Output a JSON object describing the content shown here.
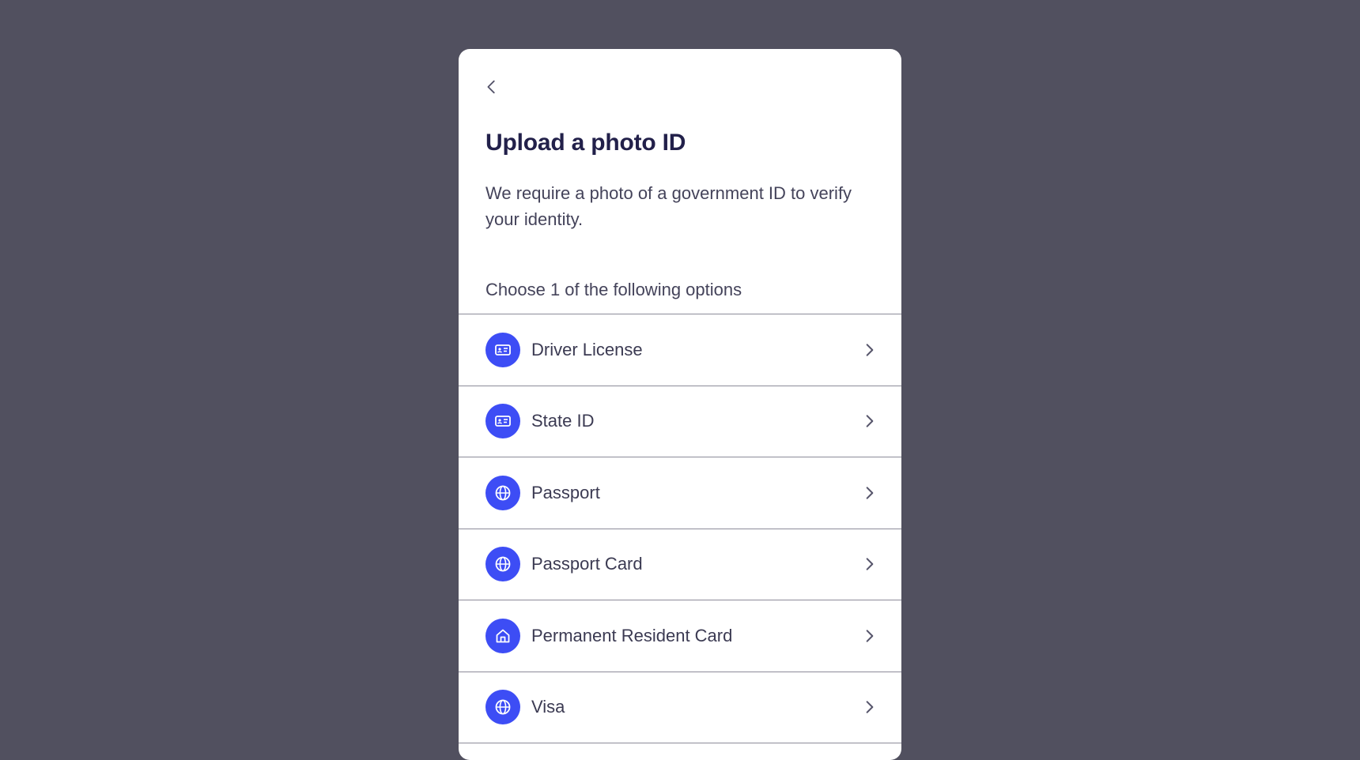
{
  "header": {
    "back_icon": "chevron-left-icon",
    "title": "Upload a photo ID",
    "description": "We require a photo of a government ID to verify your identity."
  },
  "options": {
    "label": "Choose 1 of the following options",
    "items": [
      {
        "label": "Driver License",
        "icon": "id-card-icon"
      },
      {
        "label": "State ID",
        "icon": "id-card-icon"
      },
      {
        "label": "Passport",
        "icon": "globe-icon"
      },
      {
        "label": "Passport Card",
        "icon": "globe-icon"
      },
      {
        "label": "Permanent Resident Card",
        "icon": "home-icon"
      },
      {
        "label": "Visa",
        "icon": "globe-icon"
      }
    ],
    "chevron_icon": "chevron-right-icon"
  },
  "colors": {
    "background": "#51505f",
    "card": "#ffffff",
    "accent": "#3d4df5",
    "title": "#22204a",
    "text": "#44435a",
    "divider": "#8c8b99"
  }
}
